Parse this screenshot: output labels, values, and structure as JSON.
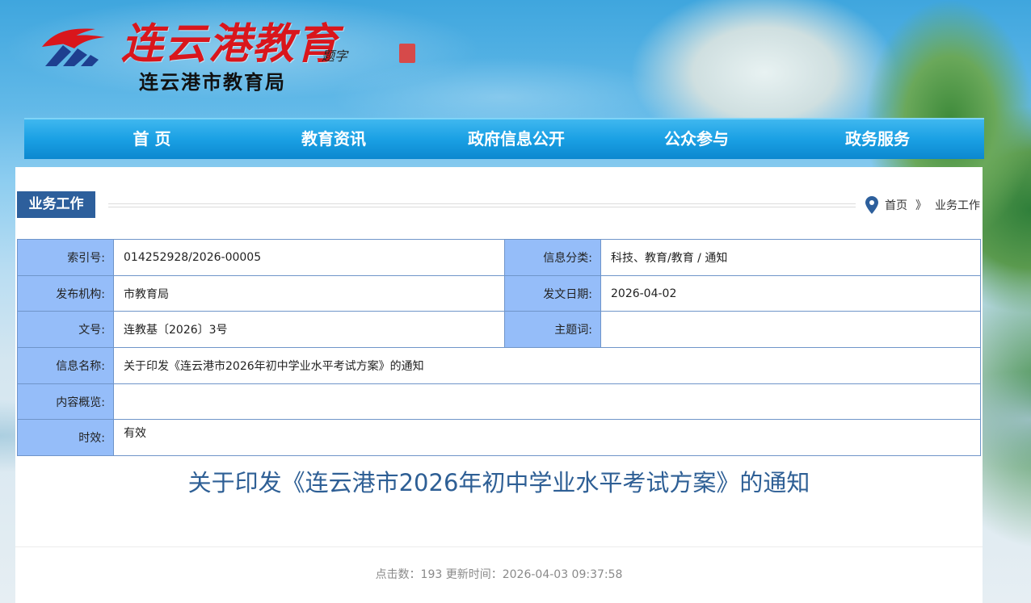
{
  "header": {
    "logo_title": "连云港教育",
    "logo_subtitle": "连云港市教育局",
    "signature": "题字"
  },
  "nav": {
    "items": [
      "首 页",
      "教育资讯",
      "政府信息公开",
      "公众参与",
      "政务服务"
    ]
  },
  "section": {
    "title": "业务工作"
  },
  "breadcrumb": {
    "home": "首页",
    "separator": "》",
    "current": "业务工作"
  },
  "info": {
    "index_label": "索引号:",
    "index_value": "014252928/2026-00005",
    "category_label": "信息分类:",
    "category_value": "科技、教育/教育 / 通知",
    "publisher_label": "发布机构:",
    "publisher_value": "市教育局",
    "date_label": "发文日期:",
    "date_value": "2026-04-02",
    "doc_no_label": "文号:",
    "doc_no_value": "连教基〔2026〕3号",
    "keywords_label": "主题词:",
    "keywords_value": "",
    "name_label": "信息名称:",
    "name_value": "关于印发《连云港市2026年初中学业水平考试方案》的通知",
    "summary_label": "内容概览:",
    "summary_value": "",
    "validity_label": "时效:",
    "validity_value": "有效"
  },
  "document": {
    "title": "关于印发《连云港市2026年初中学业水平考试方案》的通知",
    "meta": "点击数：193 更新时间：2026-04-03 09:37:58"
  },
  "colors": {
    "nav_blue": "#1aa0e4",
    "label_blue": "#95bdf9",
    "tab_blue": "#2d5f9c",
    "title_blue": "#2e5f95",
    "logo_red": "#d9161c"
  }
}
